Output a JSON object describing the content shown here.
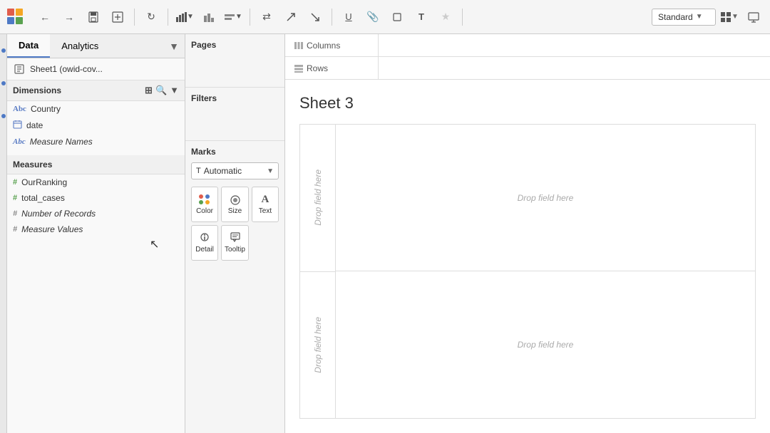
{
  "toolbar": {
    "nav_back": "←",
    "nav_forward": "→",
    "save_icon": "💾",
    "new_ds_icon": "📊",
    "refresh_icon": "↻",
    "chart_icon": "📈",
    "bar_icon": "▦",
    "swap_icon": "⇄",
    "sort_asc": "↑",
    "sort_desc": "↓",
    "underline_icon": "U",
    "paperclip_icon": "📎",
    "T_icon": "T",
    "star_icon": "★",
    "standard_label": "Standard",
    "view_icon": "▦",
    "present_icon": "⬛"
  },
  "left_panel": {
    "tab_data": "Data",
    "tab_analytics": "Analytics",
    "sheet_name": "Sheet1 (owid-cov...",
    "dimensions_label": "Dimensions",
    "dimensions_fields": [
      {
        "type": "abc",
        "name": "Country",
        "italic": false
      },
      {
        "type": "cal",
        "name": "date",
        "italic": false
      },
      {
        "type": "abc",
        "name": "Measure Names",
        "italic": true
      }
    ],
    "measures_label": "Measures",
    "measures_fields": [
      {
        "type": "hash",
        "name": "OurRanking",
        "italic": false
      },
      {
        "type": "hash",
        "name": "total_cases",
        "italic": false
      },
      {
        "type": "hash",
        "name": "Number of Records",
        "italic": true
      },
      {
        "type": "hash",
        "name": "Measure Values",
        "italic": true
      }
    ]
  },
  "middle_panel": {
    "pages_label": "Pages",
    "filters_label": "Filters",
    "marks_label": "Marks",
    "marks_type": "Automatic",
    "marks_buttons": [
      {
        "label": "Color"
      },
      {
        "label": "Size"
      },
      {
        "label": "Text"
      },
      {
        "label": "Detail"
      },
      {
        "label": "Tooltip"
      }
    ]
  },
  "canvas": {
    "columns_label": "Columns",
    "rows_label": "Rows",
    "sheet_title": "Sheet 3",
    "drop_field_here": "Drop field here",
    "drop_field_left": "Drop field here"
  }
}
